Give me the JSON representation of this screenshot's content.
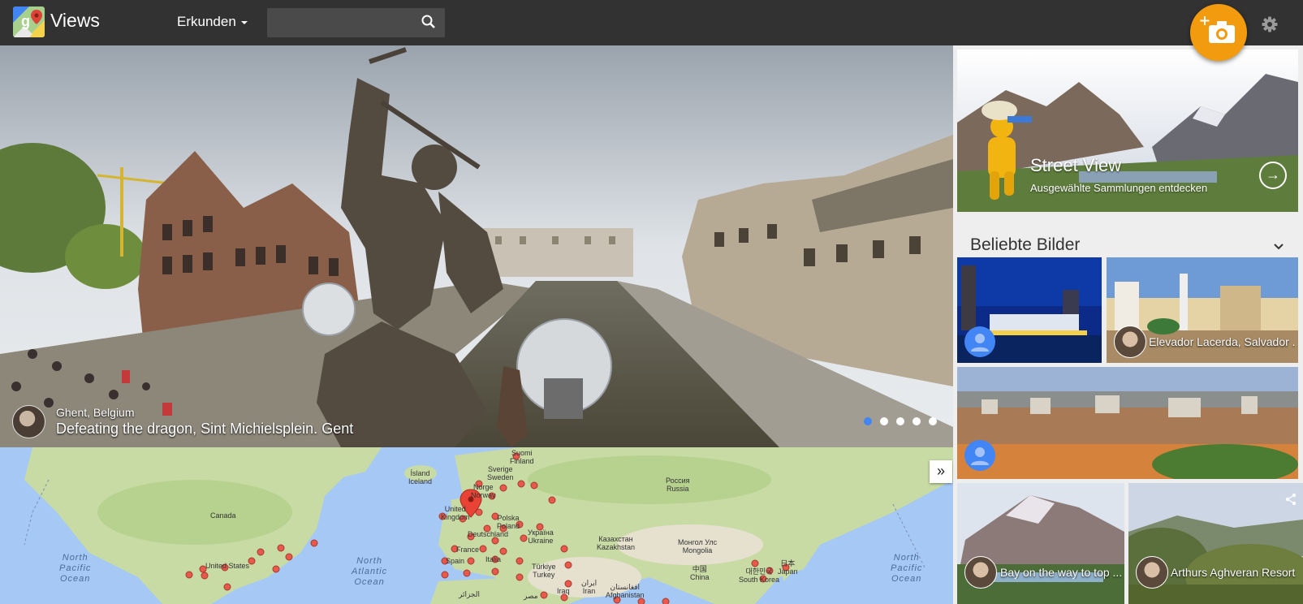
{
  "header": {
    "app_title": "Views",
    "explore_label": "Erkunden",
    "search_placeholder": "",
    "accent_color": "#f29b0f"
  },
  "hero": {
    "location": "Ghent, Belgium",
    "title": "Defeating the dragon, Sint Michielsplein. Gent",
    "slides_count": 5,
    "active_slide": 1
  },
  "map": {
    "expand_label": "»",
    "labels": [
      {
        "text": "Suomi\nFinland"
      },
      {
        "text": "Sverige\nSweden"
      },
      {
        "text": "Ísland\nIceland"
      },
      {
        "text": "Norge\nNorway"
      },
      {
        "text": "United\nKingdom"
      },
      {
        "text": "Polska\nPoland"
      },
      {
        "text": "Deutschland"
      },
      {
        "text": "France"
      },
      {
        "text": "Україна\nUkraine"
      },
      {
        "text": "Italia"
      },
      {
        "text": "Spain"
      },
      {
        "text": "Россия\nRussia"
      },
      {
        "text": "Казахстан\nKazakhstan"
      },
      {
        "text": "Монгол Улс\nMongolia"
      },
      {
        "text": "Türkiye\nTurkey"
      },
      {
        "text": "中国\nChina"
      },
      {
        "text": "대한민국\nSouth Korea"
      },
      {
        "text": "日本\nJapan"
      },
      {
        "text": "Canada"
      },
      {
        "text": "United States"
      },
      {
        "text": "الجزائر"
      },
      {
        "text": "مصر"
      },
      {
        "text": "Iraq"
      },
      {
        "text": "ایران\nIran"
      },
      {
        "text": "افغانستان\nAfghanistan"
      }
    ],
    "oceans": [
      {
        "text": "North\nPacific\nOcean"
      },
      {
        "text": "North\nAtlantic\nOcean"
      },
      {
        "text": "North\nPacific\nOcean"
      }
    ]
  },
  "sidebar": {
    "street_view": {
      "title": "Street View",
      "subtitle": "Ausgewählte Sammlungen entdecken"
    },
    "popular_title": "Beliebte Bilder",
    "tiles": [
      {
        "caption": ""
      },
      {
        "caption": "Elevador Lacerda, Salvador ..."
      },
      {
        "caption": ""
      },
      {
        "caption": "Bay on the way to top ..."
      },
      {
        "caption": "Arthurs Aghveran Resort"
      }
    ]
  }
}
